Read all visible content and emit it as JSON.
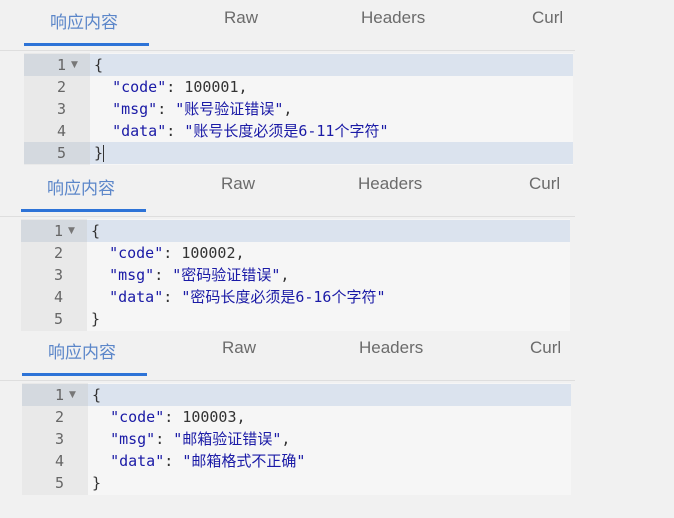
{
  "tabs": [
    "响应内容",
    "Raw",
    "Headers",
    "Curl"
  ],
  "responses": [
    {
      "lines": [
        {
          "num": "1",
          "text": "{"
        },
        {
          "num": "2",
          "key": "\"code\"",
          "value": "100001",
          "suffix": ","
        },
        {
          "num": "3",
          "key": "\"msg\"",
          "value": "\"账号验证错误\"",
          "suffix": ","
        },
        {
          "num": "4",
          "key": "\"data\"",
          "value": "\"账号长度必须是6-11个字符\"",
          "suffix": ""
        },
        {
          "num": "5",
          "text": "}"
        }
      ]
    },
    {
      "lines": [
        {
          "num": "1",
          "text": "{"
        },
        {
          "num": "2",
          "key": "\"code\"",
          "value": "100002",
          "suffix": ","
        },
        {
          "num": "3",
          "key": "\"msg\"",
          "value": "\"密码验证错误\"",
          "suffix": ","
        },
        {
          "num": "4",
          "key": "\"data\"",
          "value": "\"密码长度必须是6-16个字符\"",
          "suffix": ""
        },
        {
          "num": "5",
          "text": "}"
        }
      ]
    },
    {
      "lines": [
        {
          "num": "1",
          "text": "{"
        },
        {
          "num": "2",
          "key": "\"code\"",
          "value": "100003",
          "suffix": ","
        },
        {
          "num": "3",
          "key": "\"msg\"",
          "value": "\"邮箱验证错误\"",
          "suffix": ","
        },
        {
          "num": "4",
          "key": "\"data\"",
          "value": "\"邮箱格式不正确\"",
          "suffix": ""
        },
        {
          "num": "5",
          "text": "}"
        }
      ]
    }
  ],
  "fold_icon": "triangle-down-icon",
  "colors": {
    "active_tab": "#5b86c9",
    "underline": "#2d73d7",
    "string": "#1a1aa6"
  }
}
